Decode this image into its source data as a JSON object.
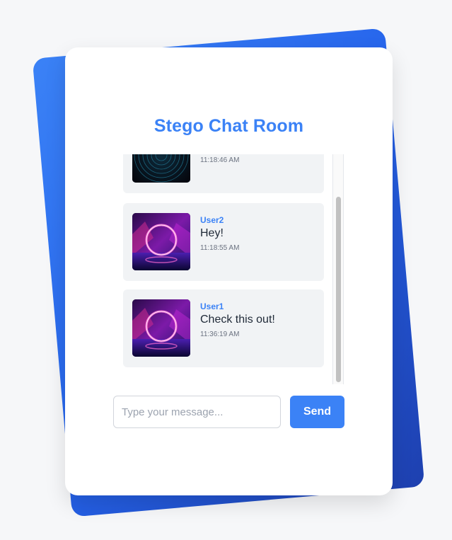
{
  "app": {
    "title": "Stego Chat Room"
  },
  "messages": [
    {
      "user": "",
      "text": "",
      "time": "11:18:46 AM",
      "image": "dark-rings-image"
    },
    {
      "user": "User2",
      "text": "Hey!",
      "time": "11:18:55 AM",
      "image": "neon-ring-image"
    },
    {
      "user": "User1",
      "text": "Check this out!",
      "time": "11:36:19 AM",
      "image": "neon-ring-image"
    }
  ],
  "composer": {
    "placeholder": "Type your message...",
    "value": "",
    "send_label": "Send"
  },
  "colors": {
    "accent": "#3b82f6",
    "accent_dark": "#1e40af",
    "message_bg": "#f1f3f5"
  }
}
